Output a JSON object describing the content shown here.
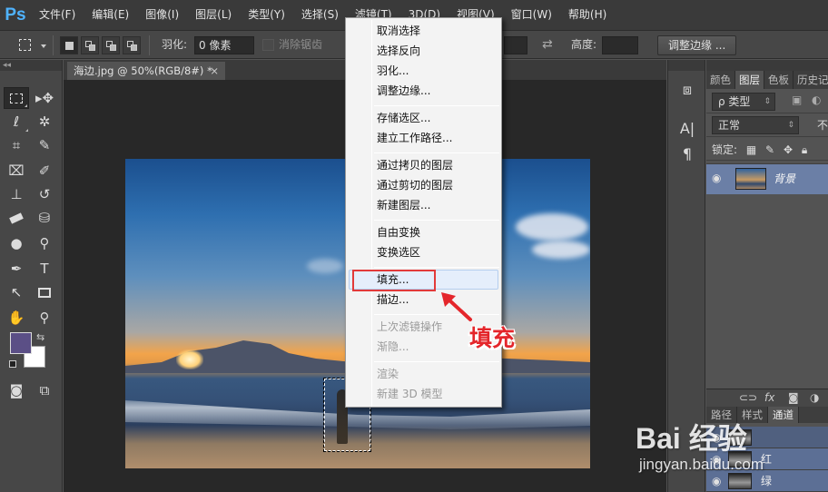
{
  "app": {
    "logo": "Ps",
    "menus": [
      "文件(F)",
      "编辑(E)",
      "图像(I)",
      "图层(L)",
      "类型(Y)",
      "选择(S)",
      "滤镜(T)",
      "3D(D)",
      "视图(V)",
      "窗口(W)",
      "帮助(H)"
    ]
  },
  "options_bar": {
    "feather_label": "羽化:",
    "feather_value": "0 像素",
    "antialias_label": "消除锯齿",
    "height_label": "高度:",
    "refine_edge_button": "调整边缘 ..."
  },
  "document": {
    "tab_title": "海边.jpg @ 50%(RGB/8#) *",
    "close_glyph": "×"
  },
  "context_menu": {
    "items": [
      {
        "label": "取消选择",
        "enabled": true
      },
      {
        "label": "选择反向",
        "enabled": true
      },
      {
        "label": "羽化...",
        "enabled": true
      },
      {
        "label": "调整边缘...",
        "enabled": true
      },
      {
        "label": "存储选区...",
        "enabled": true
      },
      {
        "label": "建立工作路径...",
        "enabled": true
      },
      {
        "label": "通过拷贝的图层",
        "enabled": true
      },
      {
        "label": "通过剪切的图层",
        "enabled": true
      },
      {
        "label": "新建图层...",
        "enabled": true
      },
      {
        "label": "自由变换",
        "enabled": true
      },
      {
        "label": "变换选区",
        "enabled": true
      },
      {
        "label": "填充...",
        "enabled": true,
        "highlighted": true
      },
      {
        "label": "描边...",
        "enabled": true
      },
      {
        "label": "上次滤镜操作",
        "enabled": false
      },
      {
        "label": "渐隐...",
        "enabled": false
      },
      {
        "label": "渲染",
        "enabled": false
      },
      {
        "label": "新建 3D 模型",
        "enabled": false
      }
    ]
  },
  "annotation": {
    "label": "填充",
    "color": "#e4262b"
  },
  "layers_panel": {
    "tabs": [
      "颜色",
      "图层",
      "色板",
      "历史记"
    ],
    "active_tab": "图层",
    "filter_label": "ρ 类型",
    "blend_mode": "正常",
    "opacity_label_partial": "不",
    "lock_label": "锁定:",
    "layers": [
      {
        "name": "背景",
        "visible": true,
        "selected": true
      }
    ]
  },
  "channels_panel": {
    "tabs": [
      "路径",
      "样式",
      "通道"
    ],
    "active_tab": "通道",
    "channels": [
      "红",
      "绿"
    ]
  },
  "colors": {
    "foreground": "#5b4f86",
    "background": "#ffffff",
    "highlight_box": "#e23a3a"
  },
  "watermark": {
    "brand": "Bai 经验",
    "url": "jingyan.baidu.com"
  }
}
